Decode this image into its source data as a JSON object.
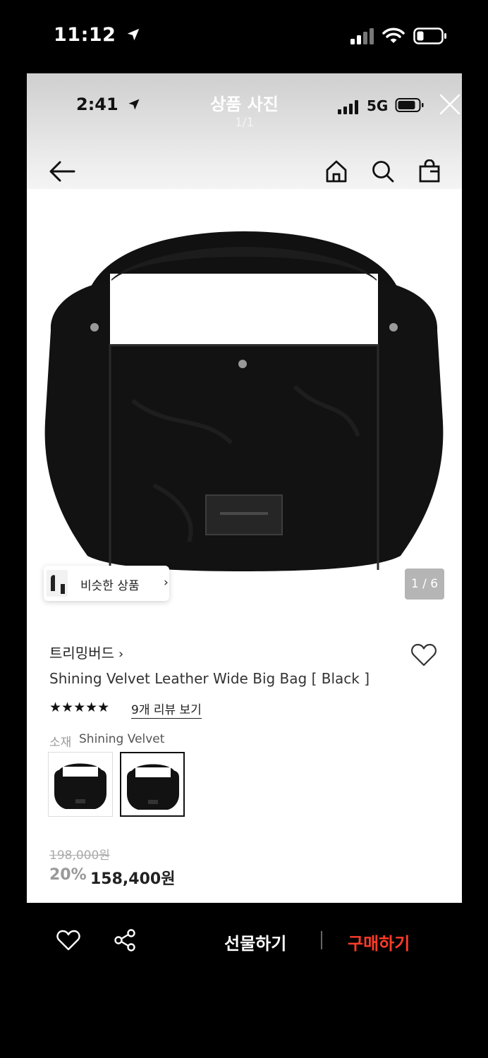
{
  "outer_status": {
    "time": "11:12"
  },
  "inner_status": {
    "time": "2:41",
    "network": "5G"
  },
  "photo_viewer": {
    "title": "상품 사진",
    "count": "1/1"
  },
  "similar_products": {
    "label": "비슷한 상품",
    "chevron": "›"
  },
  "image_counter": "1 / 6",
  "product": {
    "brand": "트리밍버드",
    "brand_chevron": "›",
    "name": "Shining Velvet Leather Wide Big Bag [ Black ]",
    "rating_stars": "★★★★★",
    "rating": 5,
    "review_link": "9개 리뷰 보기",
    "material_label": "소재",
    "material_value": "Shining Velvet",
    "original_price": "198,000원",
    "discount": "20%",
    "sale_price": "158,400원"
  },
  "swatches": [
    {
      "name": "variant-1",
      "selected": false
    },
    {
      "name": "variant-2",
      "selected": true
    }
  ],
  "actions": {
    "gift": "선물하기",
    "buy": "구매하기"
  },
  "icons": [
    "location-arrow-icon",
    "signal-icon",
    "wifi-icon",
    "battery-icon",
    "close-icon",
    "back-arrow-icon",
    "home-icon",
    "search-icon",
    "shopping-bag-icon",
    "heart-icon",
    "share-icon"
  ],
  "colors": {
    "buy_accent": "#ff3c28",
    "bag": "#121212",
    "counter_bg": "#b5b5b5"
  }
}
